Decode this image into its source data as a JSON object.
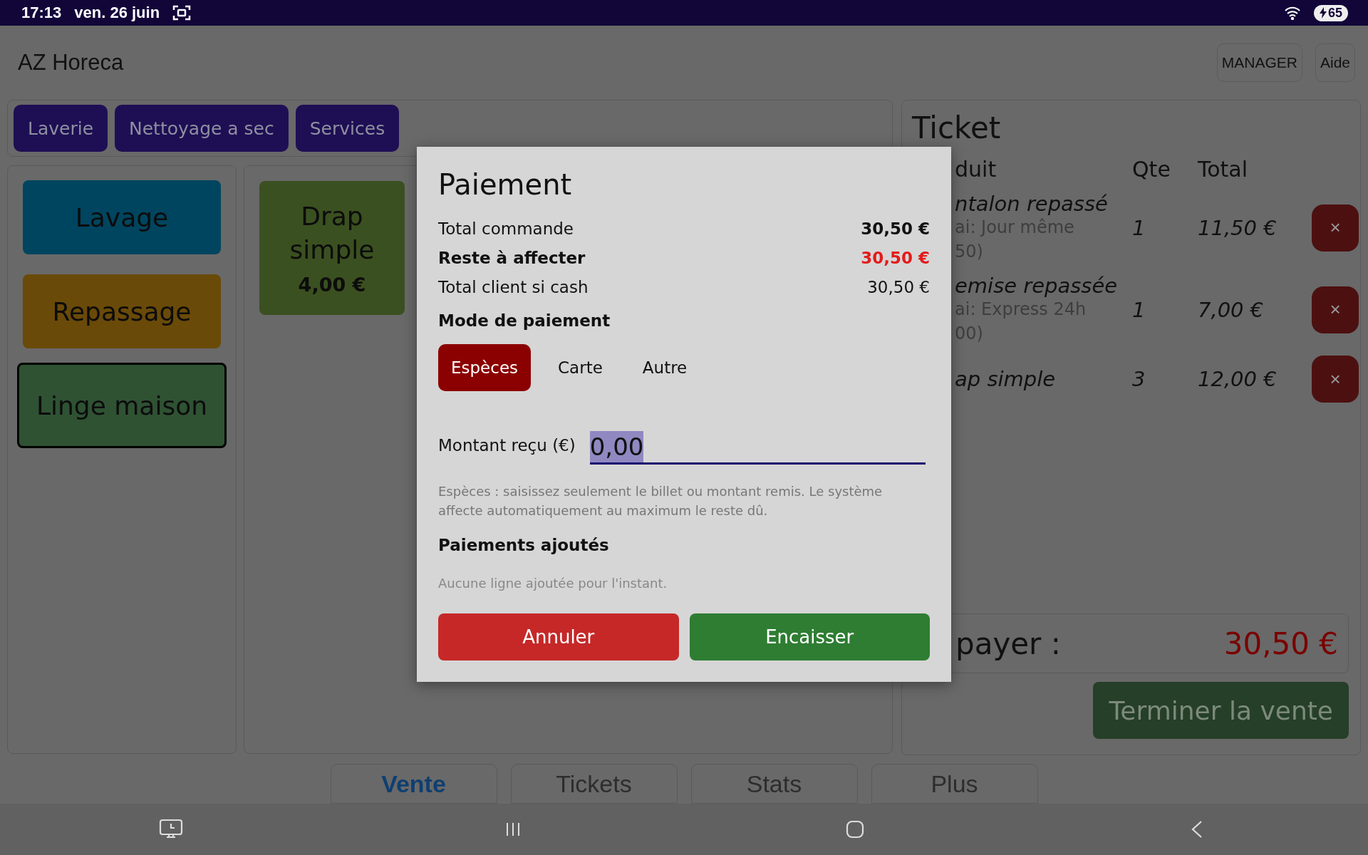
{
  "status_bar": {
    "time": "17:13",
    "date": "ven. 26 juin",
    "battery": "65"
  },
  "header": {
    "title": "AZ Horeca",
    "buttons": [
      "MANAGER",
      "Aide"
    ]
  },
  "categories": [
    {
      "label": "Laverie"
    },
    {
      "label": "Nettoyage a sec"
    },
    {
      "label": "Services"
    }
  ],
  "families": [
    {
      "label": "Lavage",
      "color": "#00455f",
      "selected": false
    },
    {
      "label": "Repassage",
      "color": "#6a4a08",
      "selected": false
    },
    {
      "label": "Linge maison",
      "color": "#2f5233",
      "selected": true
    }
  ],
  "products": [
    {
      "name": "Drap simple",
      "price": "4,00 €",
      "color": "#3b5020"
    }
  ],
  "ticket": {
    "title": "Ticket",
    "columns": [
      "duit",
      "Qte",
      "Total"
    ],
    "rows": [
      {
        "name": "ntalon repassé",
        "details": [
          "ai: Jour même",
          "50)"
        ],
        "qty": "1",
        "total": "11,50 €",
        "delete": "×"
      },
      {
        "name": "emise repassée",
        "details": [
          "ai: Express 24h",
          "00)"
        ],
        "qty": "1",
        "total": "7,00 €",
        "delete": "×"
      },
      {
        "name": "ap simple",
        "details": [],
        "qty": "3",
        "total": "12,00 €",
        "delete": "×"
      }
    ],
    "due_label": "payer :",
    "due_amount": "30,50 €",
    "finish_button": "Terminer la vente"
  },
  "nav_tabs": [
    {
      "label": "Vente",
      "selected": true
    },
    {
      "label": "Tickets",
      "selected": false
    },
    {
      "label": "Stats",
      "selected": false
    },
    {
      "label": "Plus",
      "selected": false
    }
  ],
  "modal": {
    "title": "Paiement",
    "summary": [
      {
        "label": "Total commande",
        "value": "30,50 €",
        "kind": "total"
      },
      {
        "label": "Reste à affecter",
        "value": "30,50 €",
        "kind": "remaining"
      },
      {
        "label": "Total client si cash",
        "value": "30,50 €",
        "kind": "cash"
      }
    ],
    "mode_title": "Mode de paiement",
    "modes": [
      {
        "label": "Espèces",
        "selected": true
      },
      {
        "label": "Carte",
        "selected": false
      },
      {
        "label": "Autre",
        "selected": false
      }
    ],
    "amount": {
      "label": "Montant reçu (€)",
      "value": "0,00",
      "value_selected": true
    },
    "hint": "Espèces : saisissez seulement le billet ou montant remis. Le système affecte automatiquement au maximum le reste dû.",
    "added_title": "Paiements ajoutés",
    "added_empty": "Aucune ligne ajoutée pour l'instant.",
    "buttons": [
      {
        "label": "Annuler",
        "kind": "cancel"
      },
      {
        "label": "Encaisser",
        "kind": "confirm"
      }
    ]
  }
}
